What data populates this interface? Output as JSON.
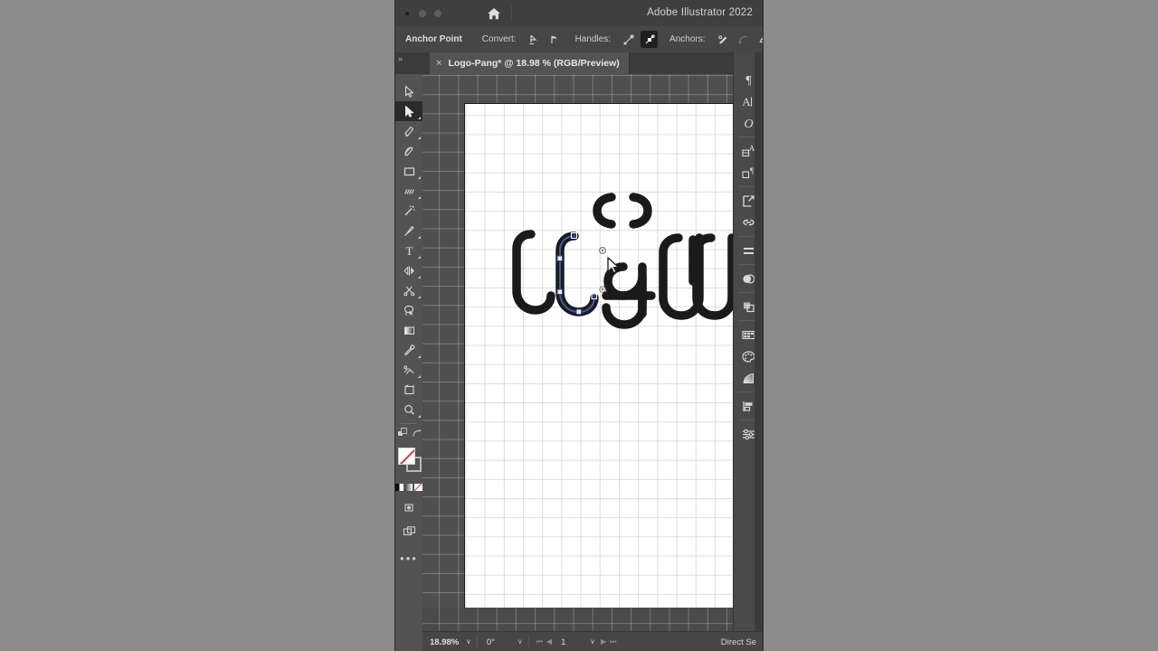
{
  "window": {
    "app_title": "Adobe Illustrator 2022",
    "home_icon": "home-icon",
    "buttons": [
      "window-button-close",
      "window-button-minimize",
      "window-button-zoom"
    ]
  },
  "control_bar": {
    "tool_name": "Anchor Point",
    "convert_label": "Convert:",
    "convert_icons": [
      "convert-to-corner-icon",
      "convert-to-smooth-icon"
    ],
    "handles_label": "Handles:",
    "handles_icons": [
      "show-handles-icon",
      "hide-handles-icon"
    ],
    "handles_active_index": 1,
    "anchors_label": "Anchors:",
    "anchors_icons": [
      "remove-anchor-icon",
      "connect-anchor-icon",
      "cut-path-icon"
    ]
  },
  "tab": {
    "close_glyph": "×",
    "title": "Logo-Pang* @ 18.98 % (RGB/Preview)",
    "expand_left_glyph": "»",
    "expand_right_glyph": "«"
  },
  "toolbar": {
    "expander_glyph": "»",
    "tools": [
      {
        "name": "selection-tool",
        "selected": false,
        "has_flyout": false
      },
      {
        "name": "direct-selection-tool",
        "selected": true,
        "has_flyout": true
      },
      {
        "name": "pen-tool",
        "selected": false,
        "has_flyout": true
      },
      {
        "name": "curvature-tool",
        "selected": false,
        "has_flyout": false
      },
      {
        "name": "rectangle-tool",
        "selected": false,
        "has_flyout": true
      },
      {
        "name": "line-segment-tool",
        "selected": false,
        "has_flyout": true
      },
      {
        "name": "magic-wand-tool",
        "selected": false,
        "has_flyout": false
      },
      {
        "name": "paintbrush-tool",
        "selected": false,
        "has_flyout": true
      },
      {
        "name": "type-tool",
        "selected": false,
        "has_flyout": true
      },
      {
        "name": "reflect-tool",
        "selected": false,
        "has_flyout": true
      },
      {
        "name": "scissors-tool",
        "selected": false,
        "has_flyout": true
      },
      {
        "name": "lasso-tool",
        "selected": false,
        "has_flyout": false
      },
      {
        "name": "gradient-tool",
        "selected": false,
        "has_flyout": false
      },
      {
        "name": "eyedropper-tool",
        "selected": false,
        "has_flyout": true
      },
      {
        "name": "blend-tool",
        "selected": false,
        "has_flyout": true
      },
      {
        "name": "artboard-tool",
        "selected": false,
        "has_flyout": false
      },
      {
        "name": "zoom-tool",
        "selected": false,
        "has_flyout": true
      }
    ],
    "swatches": {
      "fill": "none",
      "fill_color": "#ffffff",
      "stroke_color": "#535353",
      "none_slash_color": "#e03a3a",
      "swap_icon": "swap-fill-stroke-icon",
      "default_icon": "default-fill-stroke-icon"
    },
    "color_modes": [
      "color-swatch-button",
      "gradient-button",
      "none-button"
    ],
    "drawing_mode_icon": "drawing-mode-icon",
    "screen_mode_icon": "screen-mode-icon",
    "edit_toolbar_glyph": "•••"
  },
  "canvas": {
    "artboard_background": "#ffffff",
    "canvas_background": "#4f4f4f",
    "grid_color": "#d2d2d2",
    "artwork_stroke_color": "#1a1a1a",
    "selected_path_color": "#3c4f8f",
    "anchor_color": "#2a3f7a",
    "cursor_icon": "direct-selection-cursor",
    "scrollbar_icon": "vertical-scrollbar"
  },
  "right_panel": {
    "expander_glyph": "«",
    "items": [
      {
        "name": "paragraph-panel-icon",
        "glyph": "¶"
      },
      {
        "name": "character-panel-icon",
        "glyph": "A"
      },
      {
        "name": "glyphs-panel-icon",
        "glyph": "O"
      },
      {
        "name": "paragraph-styles-panel-icon",
        "glyph": ""
      },
      {
        "name": "character-styles-panel-icon",
        "glyph": ""
      },
      {
        "name": "asset-export-panel-icon",
        "glyph": ""
      },
      {
        "name": "links-panel-icon",
        "glyph": ""
      },
      {
        "name": "align-panel-icon",
        "glyph": ""
      },
      {
        "name": "transparency-panel-icon",
        "glyph": ""
      },
      {
        "name": "pathfinder-panel-icon",
        "glyph": ""
      },
      {
        "name": "swatches-panel-icon",
        "glyph": ""
      },
      {
        "name": "color-panel-icon",
        "glyph": ""
      },
      {
        "name": "gradient-panel-icon",
        "glyph": ""
      },
      {
        "name": "layers-panel-icon",
        "glyph": ""
      },
      {
        "name": "properties-panel-icon",
        "glyph": ""
      }
    ]
  },
  "status_bar": {
    "zoom_level": "18.98%",
    "rotation": "0°",
    "page_number": "1",
    "current_tool": "Direct Se",
    "first_page_glyph": "⏮",
    "prev_page_glyph": "◀",
    "next_page_glyph": "▶",
    "last_page_glyph": "⏭",
    "chevron_glyph": "∨"
  }
}
